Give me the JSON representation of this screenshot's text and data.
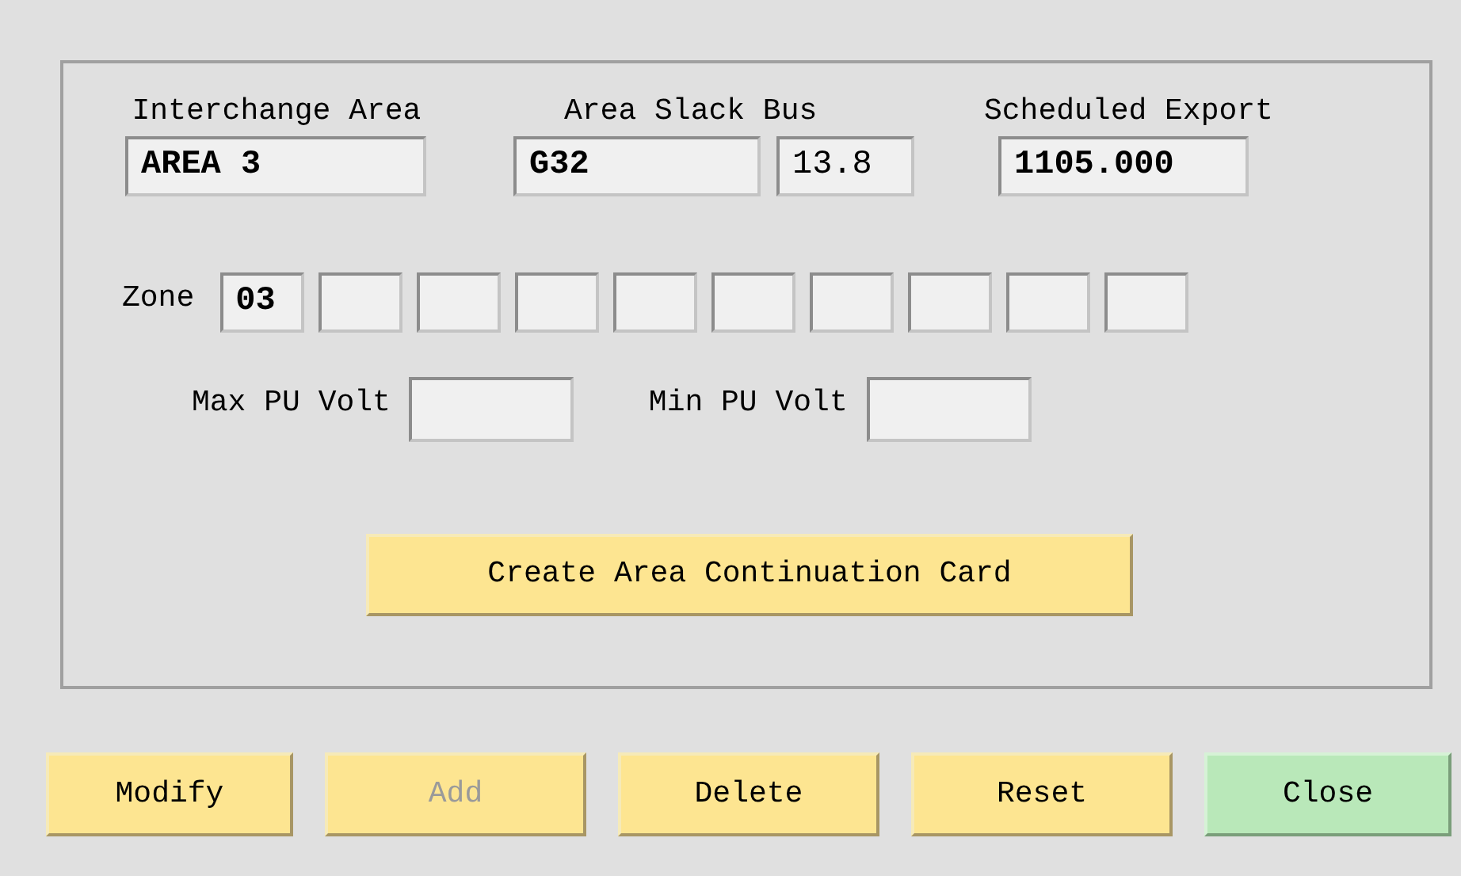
{
  "interchange_area": {
    "label": "Interchange Area",
    "value": "AREA 3"
  },
  "area_slack_bus": {
    "label": "Area Slack Bus",
    "name": "G32",
    "voltage": "13.8"
  },
  "scheduled_export": {
    "label": "Scheduled Export",
    "value": "1105.000"
  },
  "zone": {
    "label": "Zone",
    "values": [
      "03"
    ]
  },
  "max_pu_volt": {
    "label": "Max PU Volt"
  },
  "min_pu_volt": {
    "label": "Min PU Volt"
  },
  "create_button": {
    "label": "Create Area Continuation Card"
  },
  "buttons": [
    {
      "label": "Modify",
      "disabled": false,
      "kind": "action"
    },
    {
      "label": "Add",
      "disabled": true,
      "kind": "action"
    },
    {
      "label": "Delete",
      "disabled": false,
      "kind": "action"
    },
    {
      "label": "Reset",
      "disabled": false,
      "kind": "action"
    },
    {
      "label": "Close",
      "disabled": false,
      "kind": "close"
    }
  ]
}
